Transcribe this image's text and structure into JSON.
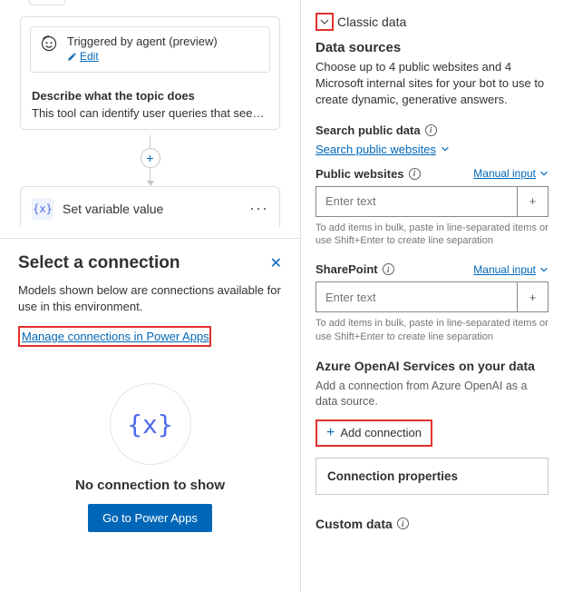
{
  "flow": {
    "trigger": {
      "title": "Triggered by agent (preview)",
      "edit_label": "Edit"
    },
    "describe_label": "Describe what the topic does",
    "describe_text": "This tool can identify user queries that seek f…",
    "set_var_label": "Set variable value"
  },
  "connection_panel": {
    "title": "Select a connection",
    "subtitle": "Models shown below are connections available for use in this environment.",
    "manage_link": "Manage connections in Power Apps",
    "empty_icon": "{x}",
    "empty_title": "No connection to show",
    "go_button": "Go to Power Apps"
  },
  "right": {
    "classic_label": "Classic data",
    "data_sources_head": "Data sources",
    "data_sources_desc": "Choose up to 4 public websites and 4 Microsoft internal sites for your bot to use to create dynamic, generative answers.",
    "search_public_label": "Search public data",
    "search_public_link": "Search public websites",
    "public_sites_label": "Public websites",
    "manual_input": "Manual input",
    "enter_text_placeholder": "Enter text",
    "bulk_help": "To add items in bulk, paste in line-separated items or use Shift+Enter to create line separation",
    "sharepoint_label": "SharePoint",
    "azure_head": "Azure OpenAI Services on your data",
    "azure_desc": "Add a connection from Azure OpenAI as a data source.",
    "add_connection_label": "Add connection",
    "conn_props_label": "Connection properties",
    "custom_data_label": "Custom data"
  }
}
